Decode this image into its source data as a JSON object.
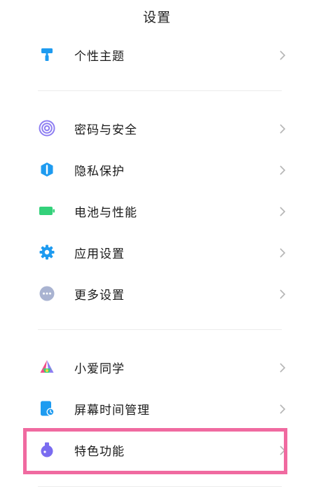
{
  "header": {
    "title": "设置"
  },
  "sections": [
    {
      "items": [
        {
          "label": "个性主题",
          "icon": "paint-roller-icon"
        }
      ]
    },
    {
      "items": [
        {
          "label": "密码与安全",
          "icon": "fingerprint-icon"
        },
        {
          "label": "隐私保护",
          "icon": "privacy-shield-icon"
        },
        {
          "label": "电池与性能",
          "icon": "battery-icon"
        },
        {
          "label": "应用设置",
          "icon": "gear-icon"
        },
        {
          "label": "更多设置",
          "icon": "more-dots-icon"
        }
      ]
    },
    {
      "items": [
        {
          "label": "小爱同学",
          "icon": "xiaoai-icon"
        },
        {
          "label": "屏幕时间管理",
          "icon": "screen-time-icon"
        },
        {
          "label": "特色功能",
          "icon": "flask-icon"
        }
      ]
    }
  ],
  "colors": {
    "highlight_border": "#f06aa0",
    "icon_blue": "#1e9bf0",
    "icon_green": "#33d17a",
    "icon_purple": "#7a6cf0",
    "icon_gray": "#a9b3d1"
  }
}
